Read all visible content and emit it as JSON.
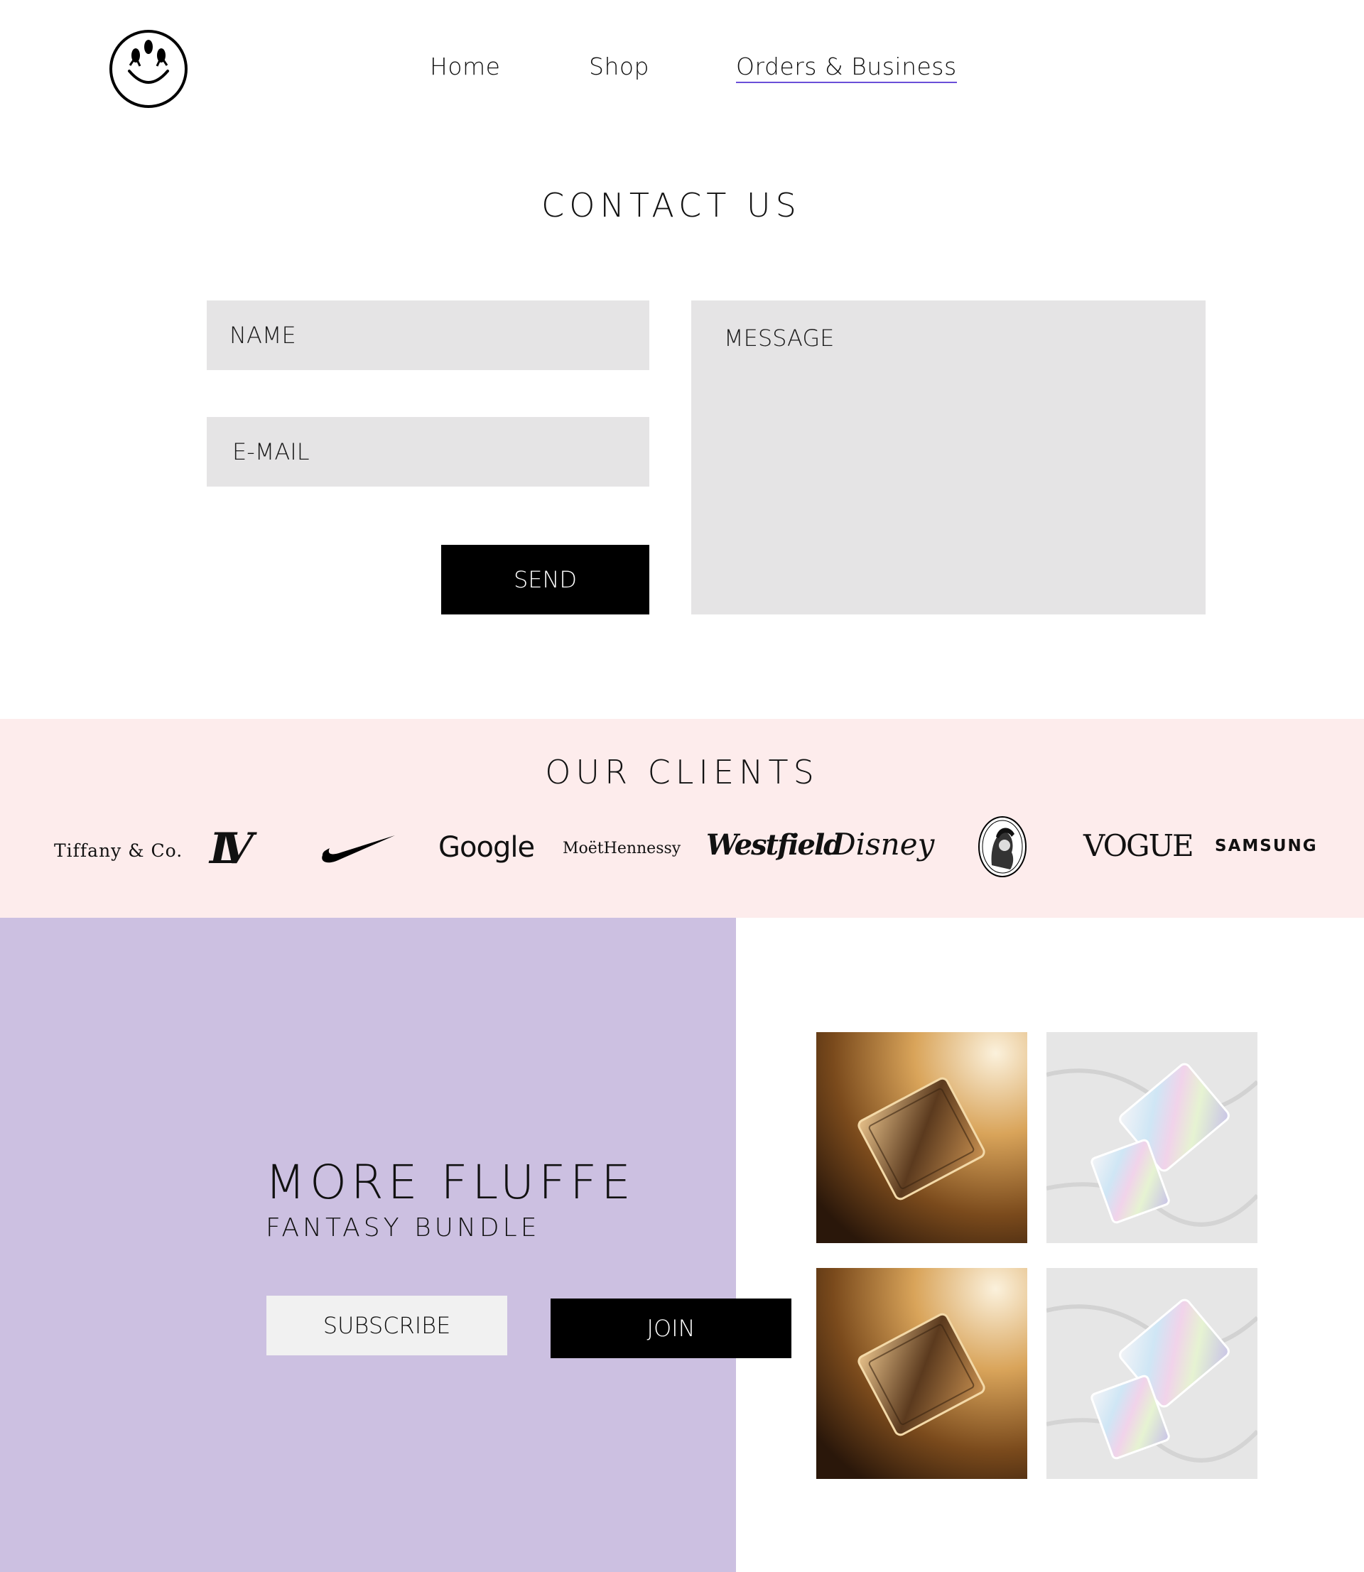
{
  "nav": {
    "home": "Home",
    "shop": "Shop",
    "orders": "Orders & Business"
  },
  "contact": {
    "title": "CONTACT US",
    "name_placeholder": "NAME",
    "email_placeholder": "E-MAIL",
    "message_placeholder": "MESSAGE",
    "send_label": "SEND"
  },
  "clients": {
    "title": "OUR CLIENTS",
    "logos": {
      "tiffany": "Tiffany & Co.",
      "lv": "LV",
      "google": "Google",
      "moet": "MoëtHennessy",
      "westfield": "Westfield",
      "disney": "Disney",
      "vogue": "VOGUE",
      "samsung": "SAMSUNG"
    }
  },
  "promo": {
    "title": "MORE FLUFFE",
    "subtitle": "FANTASY BUNDLE",
    "subscribe_label": "SUBSCRIBE",
    "join_label": "JOIN"
  },
  "colors": {
    "accent_underline": "#6a4fd8",
    "clients_band": "#fdecec",
    "promo_panel": "#ccc0e1",
    "input_bg": "#e5e4e5"
  },
  "icons": {
    "logo": "smiley-logo-icon",
    "nike": "nike-swoosh-logo",
    "amex": "amex-centurion-logo"
  }
}
